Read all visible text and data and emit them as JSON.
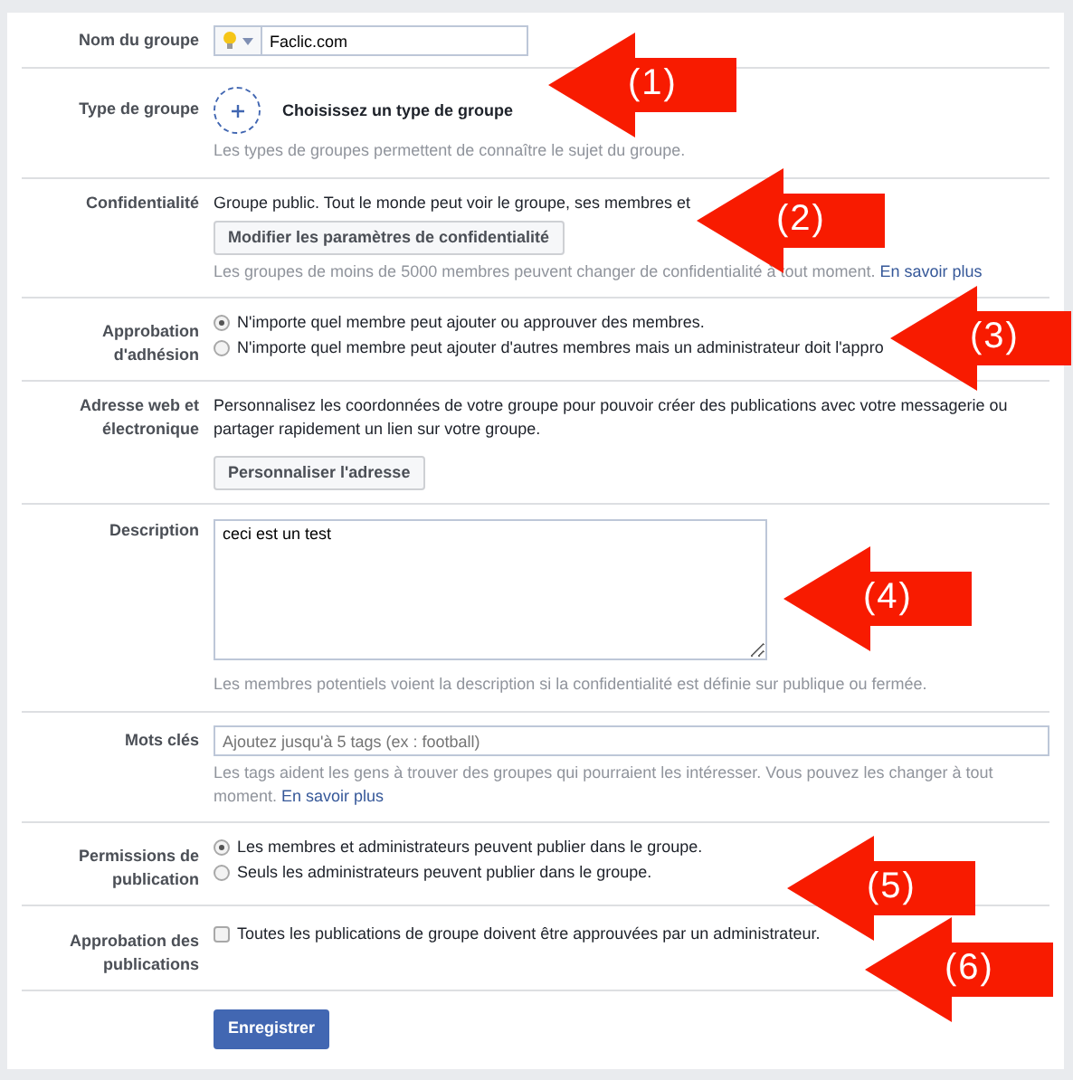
{
  "fields": [
    {
      "kind": "name",
      "label": "Nom du groupe",
      "value": "Faclic.com"
    },
    {
      "kind": "type",
      "label": "Type de groupe",
      "action": "Choisissez un type de groupe",
      "help": "Les types de groupes permettent de connaître le sujet du groupe."
    },
    {
      "kind": "privacy",
      "label": "Confidentialité",
      "text": "Groupe public. Tout le monde peut voir le groupe, ses membres et",
      "button": "Modifier les paramètres de confidentialité",
      "help": "Les groupes de moins de 5000 membres peuvent changer de confidentialité à tout moment.",
      "link": "En savoir plus"
    },
    {
      "kind": "radios",
      "label": "Approbation d'adhésion",
      "options": [
        {
          "text": "N'importe quel membre peut ajouter ou approuver des membres.",
          "selected": true
        },
        {
          "text": "N'importe quel membre peut ajouter d'autres membres mais un administrateur doit l'appro",
          "selected": false
        }
      ]
    },
    {
      "kind": "address",
      "label": "Adresse web et électronique",
      "text": "Personnalisez les coordonnées de votre groupe pour pouvoir créer des publications avec votre messagerie ou partager rapidement un lien sur votre groupe.",
      "button": "Personnaliser l'adresse"
    },
    {
      "kind": "textarea",
      "label": "Description",
      "value": "ceci est un test",
      "help": "Les membres potentiels voient la description si la confidentialité est définie sur publique ou fermée."
    },
    {
      "kind": "tags",
      "label": "Mots clés",
      "placeholder": "Ajoutez jusqu'à 5 tags (ex : football)",
      "help": "Les tags aident les gens à trouver des groupes qui pourraient les intéresser. Vous pouvez les changer à tout moment.",
      "link": "En savoir plus"
    },
    {
      "kind": "radios",
      "label": "Permissions de publication",
      "options": [
        {
          "text": "Les membres et administrateurs peuvent publier dans le groupe.",
          "selected": true
        },
        {
          "text": "Seuls les administrateurs peuvent publier dans le groupe.",
          "selected": false
        }
      ]
    },
    {
      "kind": "checkbox",
      "label": "Approbation des publications",
      "text": "Toutes les publications de groupe doivent être approuvées par un administrateur.",
      "checked": false
    }
  ],
  "save_button": "Enregistrer",
  "annotations": [
    "(1)",
    "(2)",
    "(3)",
    "(4)",
    "(5)",
    "(6)"
  ]
}
